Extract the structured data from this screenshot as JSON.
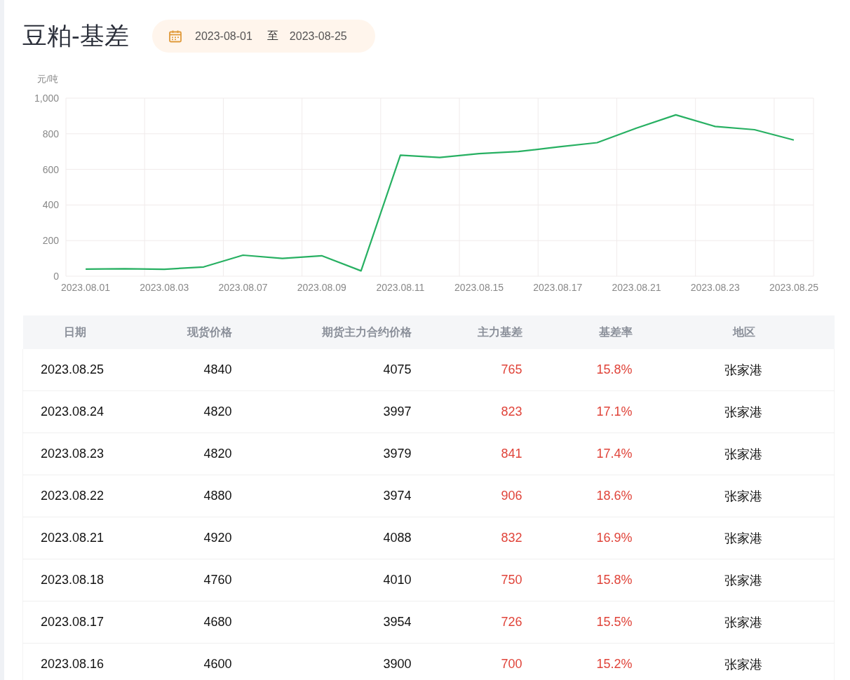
{
  "title": "豆粕-基差",
  "date_range": {
    "start": "2023-08-01",
    "separator": "至",
    "end": "2023-08-25"
  },
  "chart_data": {
    "type": "line",
    "ylabel": "元/吨",
    "categories": [
      "2023.08.01",
      null,
      "2023.08.03",
      null,
      "2023.08.07",
      null,
      "2023.08.09",
      null,
      "2023.08.11",
      null,
      "2023.08.15",
      null,
      "2023.08.17",
      null,
      "2023.08.21",
      null,
      "2023.08.23",
      null,
      "2023.08.25"
    ],
    "grid": true,
    "series": [
      {
        "color": "#27b062",
        "values": [
          40,
          42,
          39,
          52,
          118,
          100,
          115,
          30,
          680,
          667,
          688,
          700,
          726,
          750,
          832,
          906,
          841,
          823,
          765
        ]
      }
    ],
    "ylim": [
      0,
      1000
    ],
    "yticks": [
      0,
      200,
      400,
      600,
      800,
      {
        "value": 1000,
        "label": "1,000"
      }
    ]
  },
  "table": {
    "columns": [
      "日期",
      "现货价格",
      "期货主力合约价格",
      "主力基差",
      "基差率",
      "地区"
    ],
    "rows": [
      [
        "2023.08.25",
        "4840",
        "4075",
        "765",
        "15.8%",
        "张家港"
      ],
      [
        "2023.08.24",
        "4820",
        "3997",
        "823",
        "17.1%",
        "张家港"
      ],
      [
        "2023.08.23",
        "4820",
        "3979",
        "841",
        "17.4%",
        "张家港"
      ],
      [
        "2023.08.22",
        "4880",
        "3974",
        "906",
        "18.6%",
        "张家港"
      ],
      [
        "2023.08.21",
        "4920",
        "4088",
        "832",
        "16.9%",
        "张家港"
      ],
      [
        "2023.08.18",
        "4760",
        "4010",
        "750",
        "15.8%",
        "张家港"
      ],
      [
        "2023.08.17",
        "4680",
        "3954",
        "726",
        "15.5%",
        "张家港"
      ],
      [
        "2023.08.16",
        "4600",
        "3900",
        "700",
        "15.2%",
        "张家港"
      ]
    ]
  }
}
